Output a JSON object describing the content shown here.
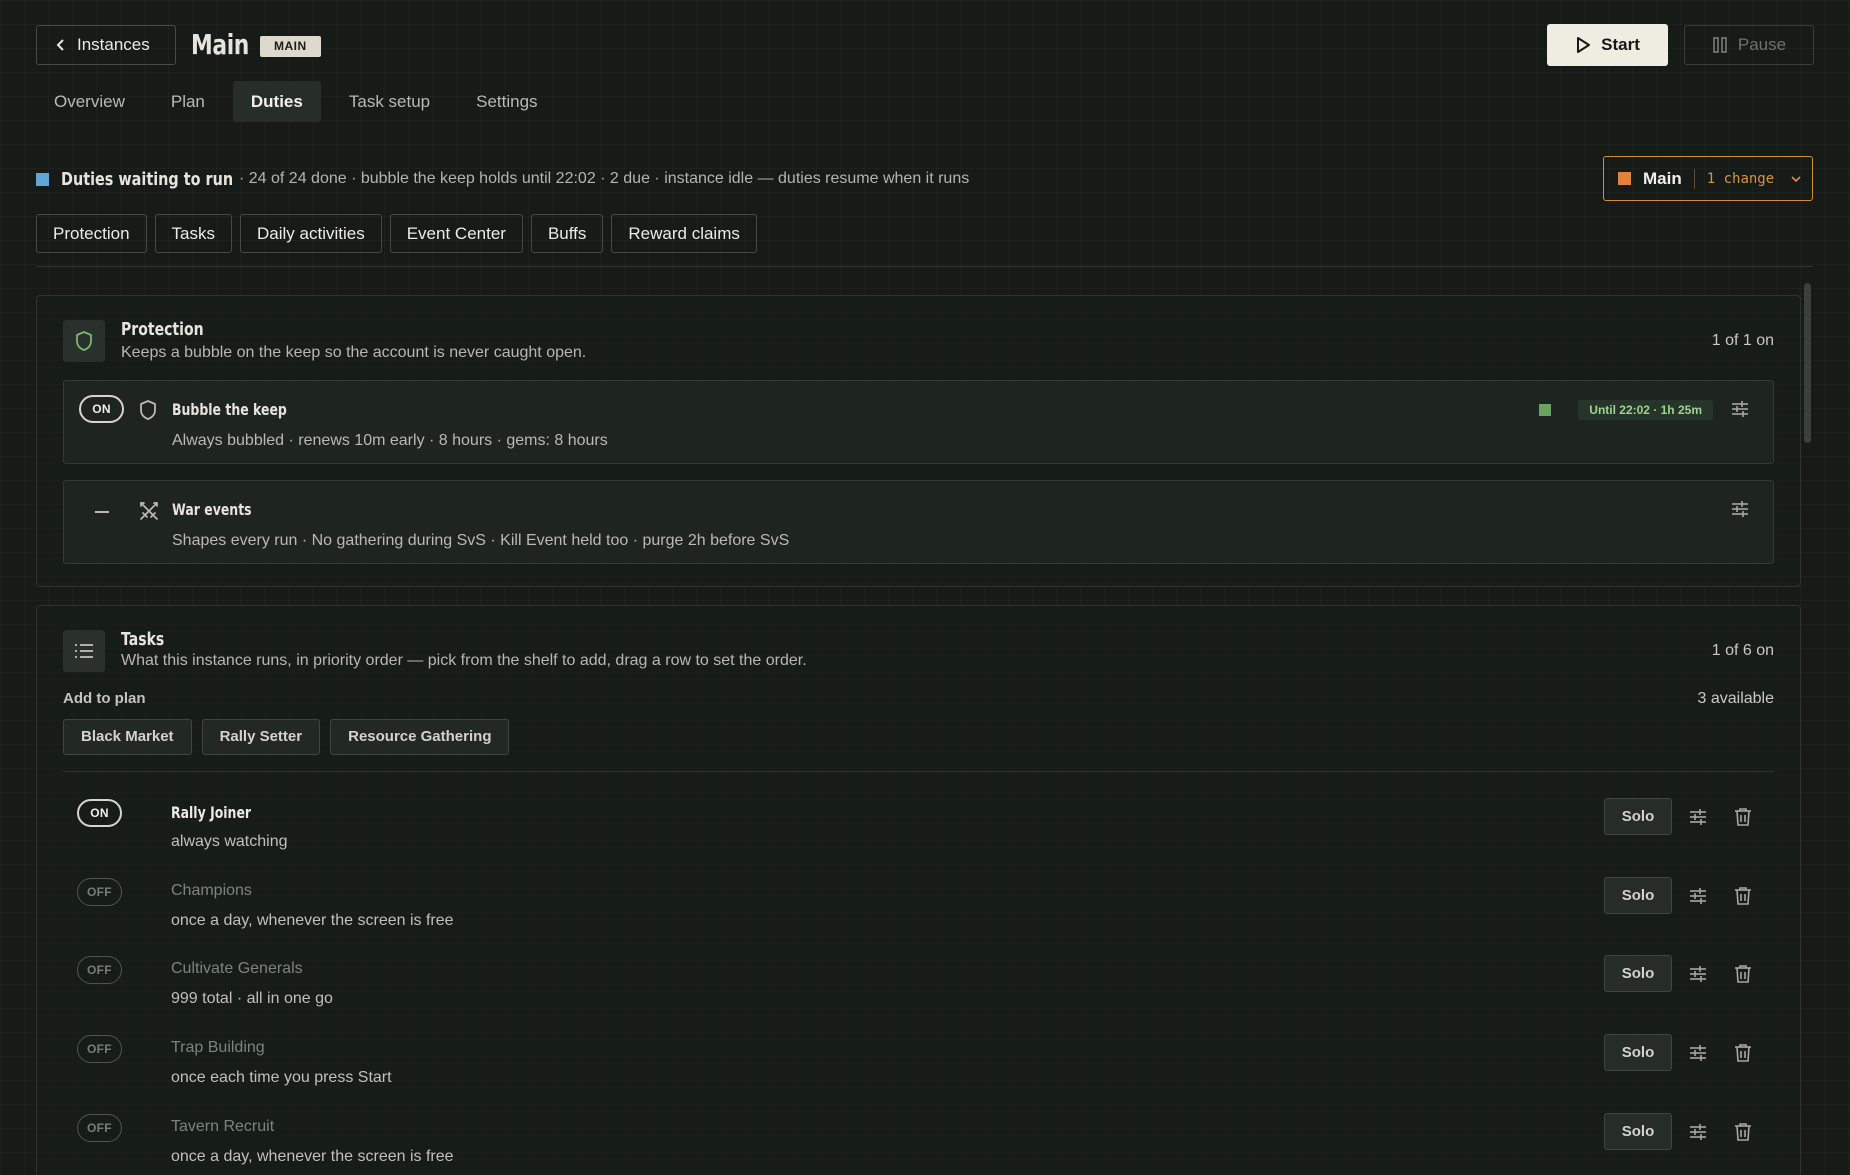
{
  "header": {
    "back_label": "Instances",
    "title": "Main",
    "badge": "MAIN",
    "start_label": "Start",
    "pause_label": "Pause"
  },
  "tabs": [
    {
      "label": "Overview"
    },
    {
      "label": "Plan"
    },
    {
      "label": "Duties",
      "active": true
    },
    {
      "label": "Task setup"
    },
    {
      "label": "Settings"
    }
  ],
  "status": {
    "title": "Duties waiting to run",
    "detail": "· 24 of 24 done · bubble the keep holds until 22:02 · 2 due · instance idle — duties resume when it runs",
    "color": "#5fa5d5"
  },
  "profile": {
    "name": "Main",
    "changes": "1 change",
    "color": "#e0833a"
  },
  "filters": [
    "Protection",
    "Tasks",
    "Daily activities",
    "Event Center",
    "Buffs",
    "Reward claims"
  ],
  "protection": {
    "title": "Protection",
    "subtitle": "Keeps a bubble on the keep so the account is never caught open.",
    "count": "1 of 1 on",
    "duties": [
      {
        "state": "ON",
        "name": "Bubble the keep",
        "desc": "Always bubbled · renews 10m early · 8 hours · gems: 8 hours",
        "until": "Until 22:02 · 1h 25m",
        "icon": "shield-icon"
      },
      {
        "state": "—",
        "name": "War events",
        "desc": "Shapes every run · No gathering during SvS · Kill Event held too · purge 2h before SvS",
        "icon": "crossed-swords-icon"
      }
    ]
  },
  "tasks": {
    "title": "Tasks",
    "subtitle": "What this instance runs, in priority order — pick from the shelf to add, drag a row to set the order.",
    "count": "1 of 6 on",
    "add_label": "Add to plan",
    "available": "3 available",
    "shelf": [
      "Black Market",
      "Rally Setter",
      "Resource Gathering"
    ],
    "solo_label": "Solo",
    "rows": [
      {
        "state": "ON",
        "on": true,
        "name": "Rally Joiner",
        "desc": "always watching"
      },
      {
        "state": "OFF",
        "on": false,
        "name": "Champions",
        "desc": "once a day, whenever the screen is free"
      },
      {
        "state": "OFF",
        "on": false,
        "name": "Cultivate Generals",
        "desc": "999 total · all in one go"
      },
      {
        "state": "OFF",
        "on": false,
        "name": "Trap Building",
        "desc": "once each time you press Start"
      },
      {
        "state": "OFF",
        "on": false,
        "name": "Tavern Recruit",
        "desc": "once a day, whenever the screen is free"
      }
    ]
  }
}
